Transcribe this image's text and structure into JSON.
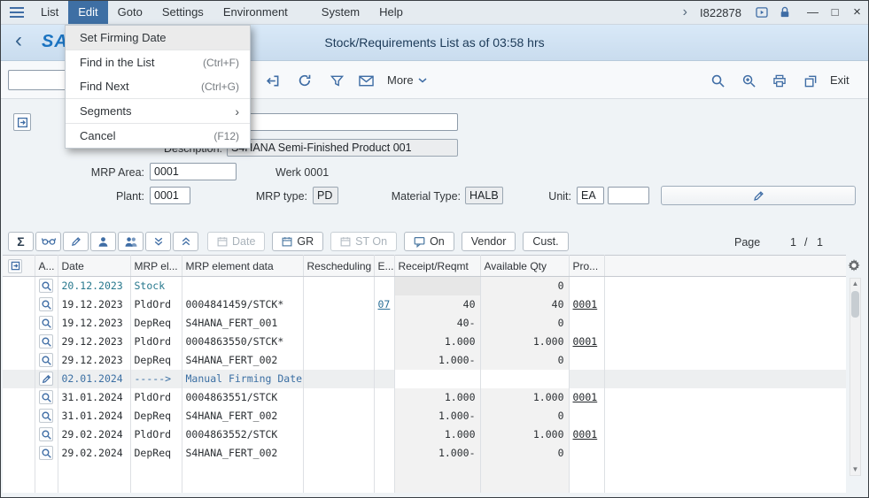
{
  "menubar": {
    "items": [
      "List",
      "Edit",
      "Goto",
      "Settings",
      "Environment",
      "System",
      "Help"
    ],
    "chevron": "›",
    "system_id": "I822878"
  },
  "window_controls": {
    "minimize": "—",
    "maximize": "□",
    "close": "×"
  },
  "titlebar": {
    "back": "‹",
    "logo": "SAP",
    "title": "Stock/Requirements List as of 03:58 hrs"
  },
  "toolbar": {
    "more": "More",
    "exit": "Exit"
  },
  "edit_menu": {
    "submenu_arrow": "›",
    "items": [
      {
        "label": "Set Firming Date",
        "shortcut": ""
      },
      {
        "label": "Find in the List",
        "shortcut": "(Ctrl+F)"
      },
      {
        "label": "Find Next",
        "shortcut": "(Ctrl+G)"
      },
      {
        "label": "Segments",
        "shortcut": ""
      },
      {
        "label": "Cancel",
        "shortcut": "(F12)"
      }
    ]
  },
  "form": {
    "material_value": "",
    "description_label": "Description:",
    "description_value": "S4HANA Semi-Finished Product 001",
    "mrp_area_label": "MRP Area:",
    "mrp_area_value": "0001",
    "werk_text": "Werk 0001",
    "plant_label": "Plant:",
    "plant_value": "0001",
    "mrp_type_label": "MRP type:",
    "mrp_type_value": "PD",
    "material_type_label": "Material Type:",
    "material_type_value": "HALB",
    "unit_label": "Unit:",
    "unit_value": "EA"
  },
  "list_toolbar": {
    "sigma": "Σ",
    "date": "Date",
    "gr": "GR",
    "st_on": "ST On",
    "on": "On",
    "vendor": "Vendor",
    "cust": "Cust.",
    "page_label": "Page",
    "page_current": "1",
    "page_separator": "/",
    "page_total": "1"
  },
  "table": {
    "headers": {
      "a": "A...",
      "date": "Date",
      "mrp_el": "MRP el...",
      "mrp_element_data": "MRP element data",
      "rescheduling": "Rescheduling ...",
      "e": "E...",
      "receipt": "Receipt/Reqmt",
      "available": "Available Qty",
      "pro": "Pro..."
    },
    "rows": [
      {
        "date": "20.12.2023",
        "mrp_el": "Stock",
        "data": "",
        "e": "",
        "receipt": "",
        "available": "0",
        "pro": ""
      },
      {
        "date": "19.12.2023",
        "mrp_el": "PldOrd",
        "data": "0004841459/STCK*",
        "e": "07",
        "receipt": "40",
        "available": "40",
        "pro": "0001"
      },
      {
        "date": "19.12.2023",
        "mrp_el": "DepReq",
        "data": "S4HANA_FERT_001",
        "e": "",
        "receipt": "40-",
        "available": "0",
        "pro": ""
      },
      {
        "date": "29.12.2023",
        "mrp_el": "PldOrd",
        "data": "0004863550/STCK*",
        "e": "",
        "receipt": "1.000",
        "available": "1.000",
        "pro": "0001"
      },
      {
        "date": "29.12.2023",
        "mrp_el": "DepReq",
        "data": "S4HANA_FERT_002",
        "e": "",
        "receipt": "1.000-",
        "available": "0",
        "pro": ""
      },
      {
        "date": "02.01.2024",
        "mrp_el": "----->",
        "data": "Manual Firming Date",
        "e": "",
        "receipt": "",
        "available": "",
        "pro": ""
      },
      {
        "date": "31.01.2024",
        "mrp_el": "PldOrd",
        "data": "0004863551/STCK",
        "e": "",
        "receipt": "1.000",
        "available": "1.000",
        "pro": "0001"
      },
      {
        "date": "31.01.2024",
        "mrp_el": "DepReq",
        "data": "S4HANA_FERT_002",
        "e": "",
        "receipt": "1.000-",
        "available": "0",
        "pro": ""
      },
      {
        "date": "29.02.2024",
        "mrp_el": "PldOrd",
        "data": "0004863552/STCK",
        "e": "",
        "receipt": "1.000",
        "available": "1.000",
        "pro": "0001"
      },
      {
        "date": "29.02.2024",
        "mrp_el": "DepReq",
        "data": "S4HANA_FERT_002",
        "e": "",
        "receipt": "1.000-",
        "available": "0",
        "pro": ""
      }
    ]
  }
}
